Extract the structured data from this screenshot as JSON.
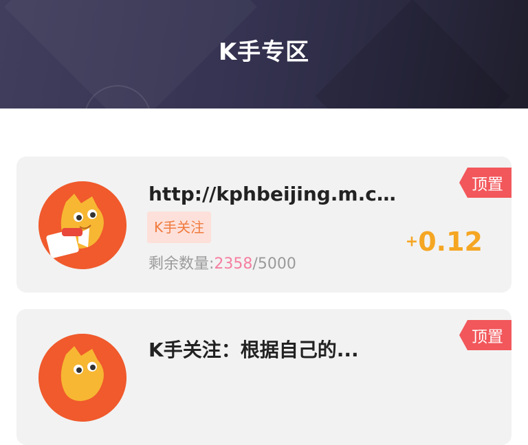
{
  "header": {
    "title": "K手专区"
  },
  "tasks": [
    {
      "title": "http://kphbeijing.m.ch...",
      "tag": "K手关注",
      "pin_label": "顶置",
      "quota_label": "剩余数量:",
      "remaining": "2358",
      "separator": "/",
      "total": "5000",
      "reward_sign": "+",
      "reward_value": "0.12",
      "avatar_icon": "orange-cat-mascot"
    },
    {
      "title": "K手关注：根据自己的...",
      "pin_label": "顶置",
      "avatar_icon": "orange-cat-mascot"
    }
  ],
  "colors": {
    "header_bg": "#353351",
    "pin_badge": "#f2575b",
    "reward": "#f5a623",
    "remaining": "#f57ea0",
    "tag_bg": "#fde0da",
    "tag_text": "#f07a3c"
  }
}
